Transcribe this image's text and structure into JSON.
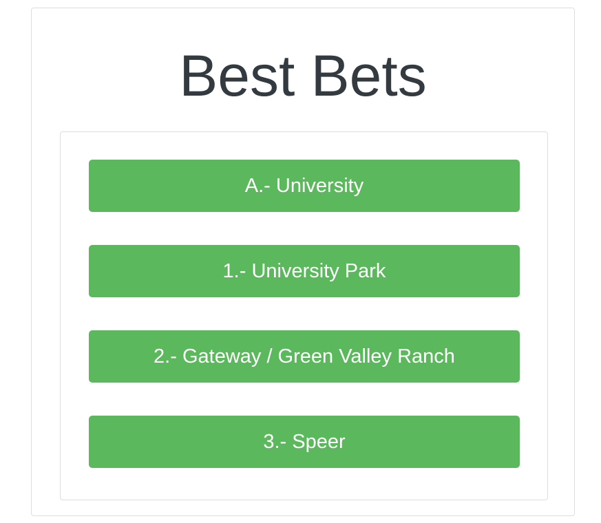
{
  "header": {
    "title": "Best Bets"
  },
  "bets": [
    {
      "label": "A.- University"
    },
    {
      "label": "1.- University Park"
    },
    {
      "label": "2.- Gateway / Green Valley Ranch"
    },
    {
      "label": "3.- Speer"
    }
  ],
  "colors": {
    "button_background": "#5cb85c",
    "button_text": "#ffffff",
    "title_text": "#333a40",
    "panel_border": "#dddddd"
  }
}
